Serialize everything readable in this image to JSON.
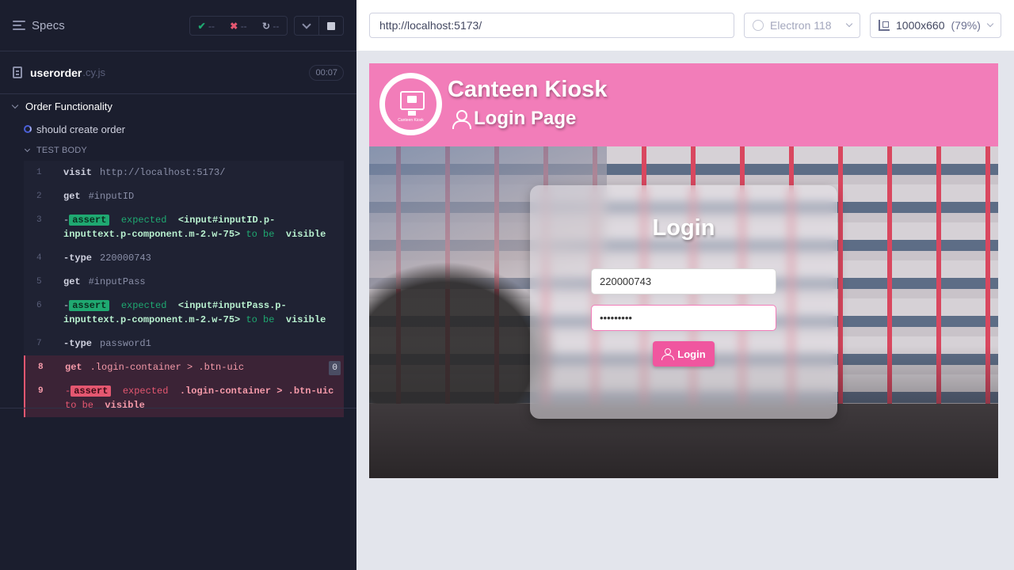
{
  "reporter": {
    "specs_label": "Specs",
    "stats": {
      "passed_icon": "✔",
      "passed": "--",
      "failed_icon": "✖",
      "failed": "--",
      "pending_icon": "↻",
      "pending": "--"
    },
    "file": {
      "name": "userorder",
      "ext": ".cy.js",
      "duration": "00:07"
    },
    "suite": "Order Functionality",
    "test": "should create order",
    "test_body": "TEST BODY",
    "commands": [
      {
        "num": "1",
        "name": "visit",
        "msg": "http://localhost:5173/"
      },
      {
        "num": "2",
        "name": "get",
        "msg": "#inputID"
      },
      {
        "num": "3",
        "dash": "-",
        "badge": "assert",
        "expected": "expected",
        "selector": "<input#inputID.p-inputtext.p-component.m-2.w-75>",
        "to_be": "to be",
        "state": "visible"
      },
      {
        "num": "4",
        "name": "-type",
        "msg": "220000743"
      },
      {
        "num": "5",
        "name": "get",
        "msg": "#inputPass"
      },
      {
        "num": "6",
        "dash": "-",
        "badge": "assert",
        "expected": "expected",
        "selector": "<input#inputPass.p-inputtext.p-component.m-2.w-75>",
        "to_be": "to be",
        "state": "visible"
      },
      {
        "num": "7",
        "name": "-type",
        "msg": "password1"
      },
      {
        "num": "8",
        "name": "get",
        "msg": ".login-container > .btn-uic",
        "count": "0"
      },
      {
        "num": "9",
        "dash": "-",
        "badge": "assert",
        "expected": "expected",
        "selector": ".login-container > .btn-uic",
        "to_be": "to be",
        "state": "visible"
      }
    ]
  },
  "aut_bar": {
    "url": "http://localhost:5173/",
    "browser": "Electron 118",
    "viewport": "1000x660",
    "viewport_pct": "(79%)"
  },
  "app": {
    "title": "Canteen Kiosk",
    "subtitle": "Login Page",
    "logo_caption": "Canteen Kiosk",
    "login_title": "Login",
    "id_value": "220000743",
    "password_value": "•••••••••",
    "login_button": "Login"
  },
  "colors": {
    "reporter_bg": "#1b1e2e",
    "pass": "#1fa971",
    "fail": "#e45770",
    "app_pink": "#f27db9",
    "button_pink": "#f0569f"
  }
}
